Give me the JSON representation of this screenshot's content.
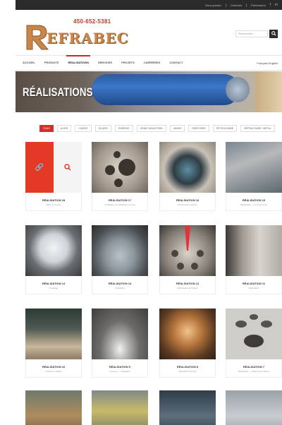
{
  "topbar": {
    "links": [
      "Nous joindre",
      "Carrières",
      "Partenaires"
    ],
    "icons": [
      "facebook-icon",
      "linkedin-icon"
    ]
  },
  "header": {
    "phone": "450-652-5381",
    "logo_text": "EFRABEC",
    "search_placeholder": "Rechercher...",
    "search_icon": "search-icon"
  },
  "nav": {
    "items": [
      "ACCUEIL",
      "PRODUITS",
      "RÉALISATIONS",
      "SERVICES",
      "PROJETS",
      "CARRIÈRES",
      "CONTACT"
    ],
    "active_index": 2,
    "language": "Français  English"
  },
  "hero": {
    "title": "RÉALISATIONS"
  },
  "filters": {
    "items": [
      "TOUS",
      "ACIER",
      "CIMENT",
      "DIVERS",
      "ÉNERGIE",
      "GÉNIE INDUSTRIEL",
      "MINES",
      "PAPETIÈRE",
      "PÉTROCHIMIE",
      "RÉFRACTAIRE / MÉTAL"
    ],
    "active_index": 0
  },
  "gallery": {
    "items": [
      {
        "title": "RÉALISATION 18",
        "subtitle": "Mise en service"
      },
      {
        "title": "RÉALISATION 17",
        "subtitle": "Installation de réfractaire sur site"
      },
      {
        "title": "RÉALISATION 16",
        "subtitle": "Revêtement cylindre"
      },
      {
        "title": "RÉALISATION 15",
        "subtitle": "Réfractaire — Four de recuit"
      },
      {
        "title": "RÉALISATION 14",
        "subtitle": "Cuvelage"
      },
      {
        "title": "RÉALISATION 13",
        "subtitle": "Chaudière"
      },
      {
        "title": "RÉALISATION 12",
        "subtitle": "Réfractaire de brûleur"
      },
      {
        "title": "RÉALISATION 11",
        "subtitle": "Réfractaire"
      },
      {
        "title": "RÉALISATION 10",
        "subtitle": "Coulée en atelier"
      },
      {
        "title": "RÉALISATION 9",
        "subtitle": "Cyclone — réfractaire"
      },
      {
        "title": "RÉALISATION 8",
        "subtitle": "Réfractaire de four"
      },
      {
        "title": "RÉALISATION 7",
        "subtitle": "Réfractaire — Plaque de brûleurs"
      },
      {
        "title": "",
        "subtitle": ""
      },
      {
        "title": "",
        "subtitle": ""
      },
      {
        "title": "",
        "subtitle": ""
      },
      {
        "title": "",
        "subtitle": ""
      }
    ],
    "overlay_icons": [
      "link-icon",
      "zoom-icon"
    ]
  },
  "colors": {
    "accent": "#d32f2f",
    "topbar": "#2b2b2b",
    "logo": "#c9854a"
  }
}
